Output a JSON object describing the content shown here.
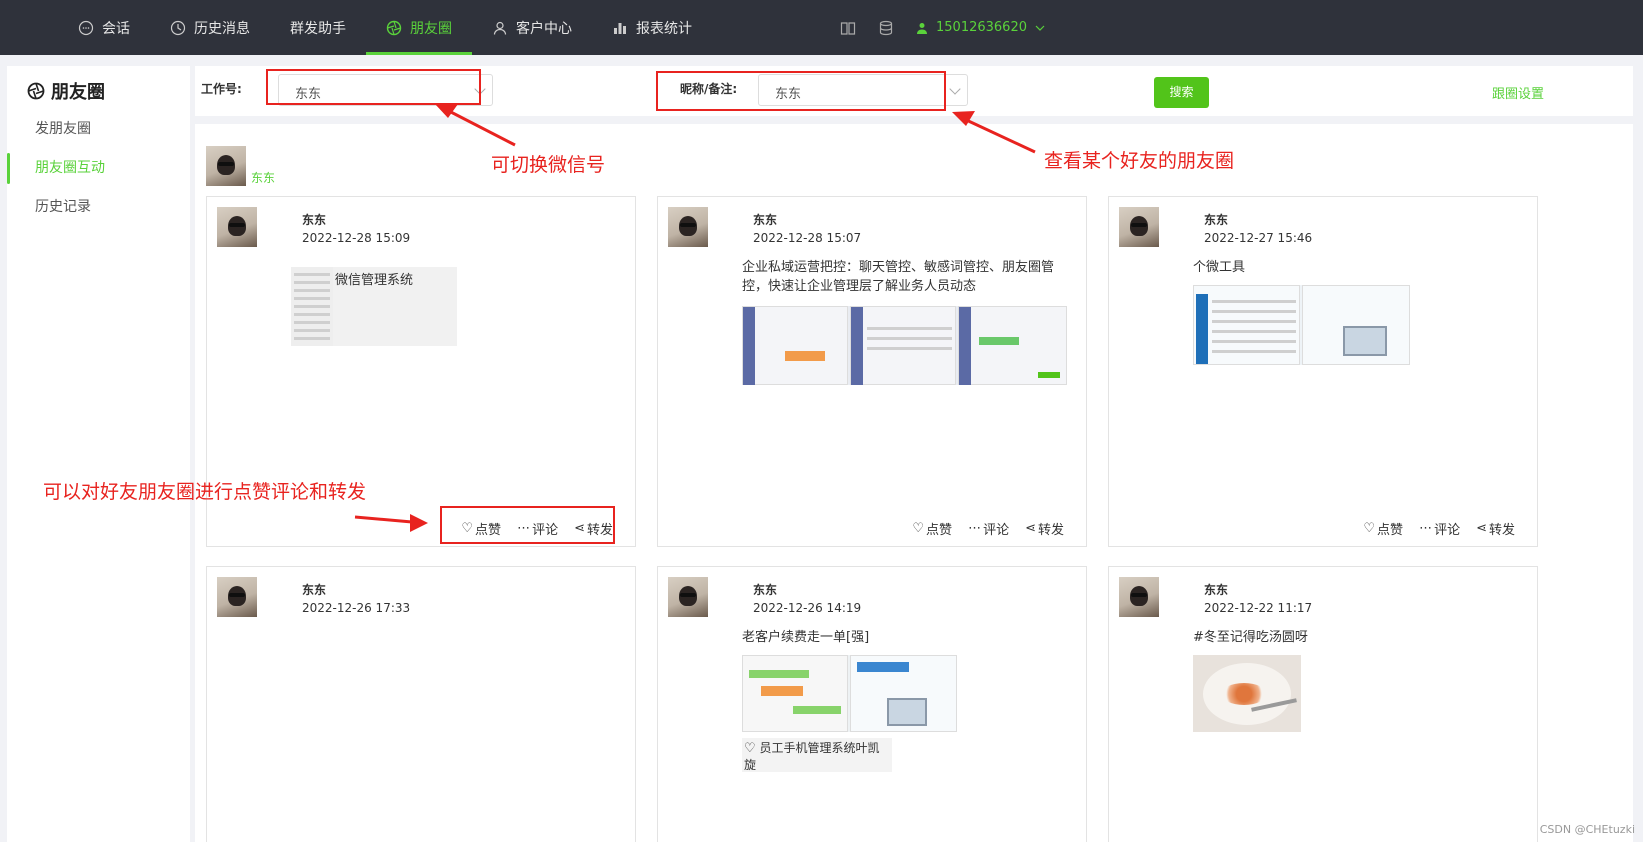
{
  "topbar": {
    "nav": [
      {
        "label": "会话",
        "icon": "chat-icon",
        "active": false
      },
      {
        "label": "历史消息",
        "icon": "clock-icon",
        "active": false
      },
      {
        "label": "群发助手",
        "icon": "",
        "active": false
      },
      {
        "label": "朋友圈",
        "icon": "aperture-icon",
        "active": true
      },
      {
        "label": "客户中心",
        "icon": "user-icon",
        "active": false
      },
      {
        "label": "报表统计",
        "icon": "bar-chart-icon",
        "active": false
      }
    ],
    "phone": "15012636620",
    "accent": "#5ad23b"
  },
  "sidebar": {
    "title": "朋友圈",
    "items": [
      {
        "label": "发朋友圈",
        "active": false
      },
      {
        "label": "朋友圈互动",
        "active": true
      },
      {
        "label": "历史记录",
        "active": false
      }
    ]
  },
  "filters": {
    "work_id_label": "工作号:",
    "work_id_value": "东东",
    "nickname_label": "昵称/备注:",
    "nickname_value": "东东",
    "search_label": "搜索",
    "follow_settings_label": "跟圈设置"
  },
  "friend": {
    "name": "东东"
  },
  "posts": [
    {
      "name": "东东",
      "time": "2022-12-28 15:09",
      "text": "",
      "thumb_caption": "微信管理系统",
      "like": "点赞",
      "comment": "评论",
      "share": "转发"
    },
    {
      "name": "东东",
      "time": "2022-12-28 15:07",
      "text": "企业私域运营把控：聊天管控、敏感词管控、朋友圈管控，快速让企业管理层了解业务人员动态",
      "like": "点赞",
      "comment": "评论",
      "share": "转发"
    },
    {
      "name": "东东",
      "time": "2022-12-27 15:46",
      "text": "个微工具",
      "like": "点赞",
      "comment": "评论",
      "share": "转发"
    },
    {
      "name": "东东",
      "time": "2022-12-26 17:33",
      "text": ""
    },
    {
      "name": "东东",
      "time": "2022-12-26 14:19",
      "text": "老客户续费走一单[强]",
      "likes": "员工手机管理系统叶凯旋"
    },
    {
      "name": "东东",
      "time": "2022-12-22 11:17",
      "text": "#冬至记得吃汤圆呀"
    }
  ],
  "annotations": {
    "switch_wechat": "可切换微信号",
    "view_friend": "查看某个好友的朋友圈",
    "interact": "可以对好友朋友圈进行点赞评论和转发",
    "color": "#e8231f"
  },
  "watermark": "CSDN @CHEtuzki"
}
